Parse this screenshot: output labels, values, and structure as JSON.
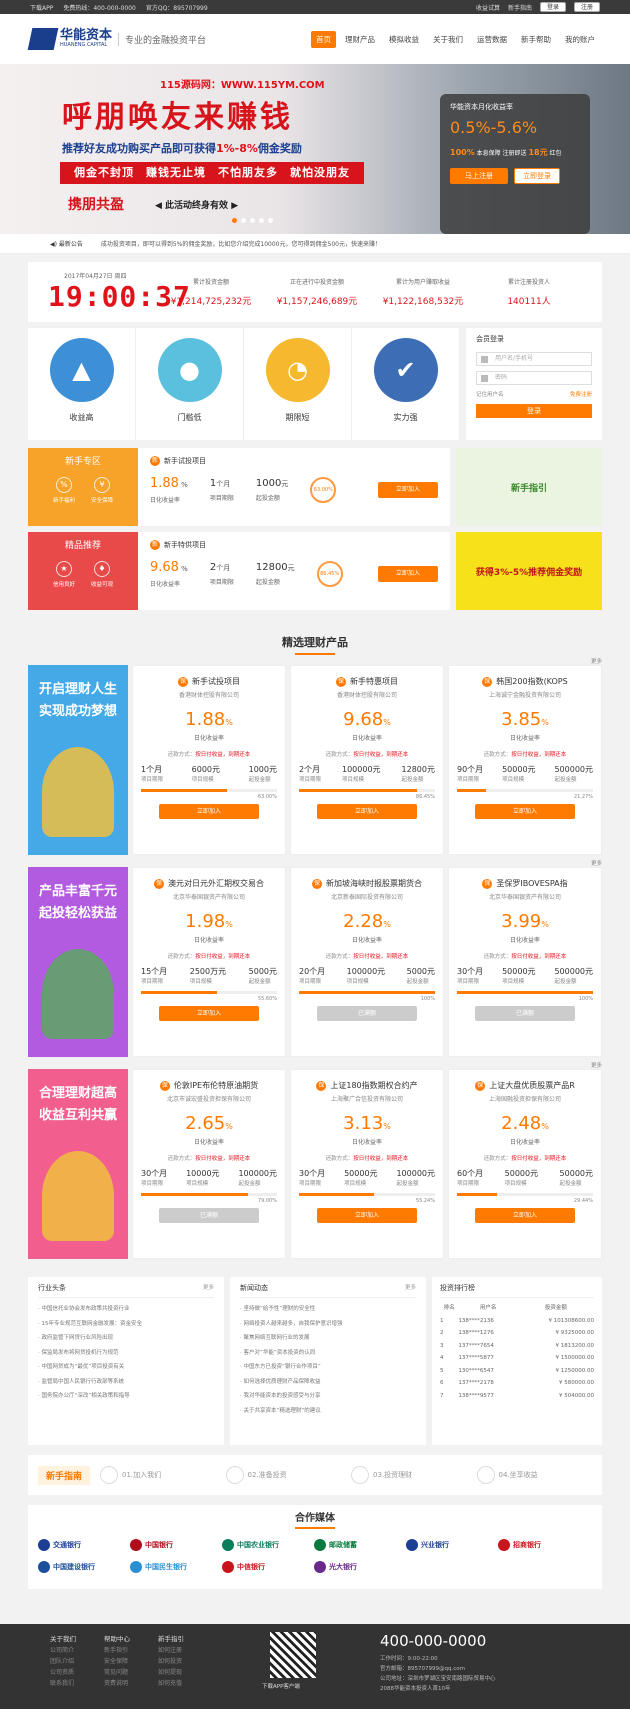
{
  "topbar": {
    "app": "下载APP",
    "hotline": "免费热线：400-000-0000",
    "qq": "官方QQ：895707999",
    "links": [
      "收益试算",
      "新手指南"
    ],
    "login": "登录",
    "register": "注册"
  },
  "header": {
    "logo_cn": "华能资本",
    "logo_en": "HUANENG CAPITAL",
    "slogan": "专业的金融投资平台",
    "nav": [
      "首页",
      "理财产品",
      "模拟收益",
      "关于我们",
      "运营数据",
      "新手帮助",
      "我的账户"
    ]
  },
  "banner": {
    "site": "115源码网：WWW.115YM.COM",
    "title": "呼朋唤友来赚钱",
    "sub_a": "推荐好友成功购买产品即可获得",
    "sub_b": "1%-8%",
    "sub_c": "佣金奖励",
    "red": "佣金不封顶　赚钱无止境　不怕朋友多　就怕没朋友",
    "sign": "携朋共盈",
    "sign2": "◀ 此活动终身有效 ▶",
    "card_label": "华能资本月化收益率",
    "card_rate": "0.5%-5.6%",
    "card_line_a": "100%",
    "card_line_b": "本息保障 注册即送",
    "card_line_c": "18元",
    "card_line_d": "红包",
    "card_btn1": "马上注册",
    "card_btn2": "立即登录"
  },
  "notice": {
    "label": "最新公告",
    "text": "成功投资项目，即可以得到5%的佣金奖励，比如您介绍完成10000元，您可得到佣金500元，快速来赚！"
  },
  "stats": {
    "date": "2017年04月27日 周四",
    "clock": "19:00:37",
    "items": [
      {
        "k": "累计投资金额",
        "v": "¥1,214,725,232元"
      },
      {
        "k": "正在进行中投资金额",
        "v": "¥1,157,246,689元"
      },
      {
        "k": "累计为用户赚取收益",
        "v": "¥1,122,168,532元"
      },
      {
        "k": "累计注册投资人",
        "v": "140111人"
      }
    ]
  },
  "features": [
    {
      "t": "收益高",
      "c": "#3d8fd6",
      "g": "▲"
    },
    {
      "t": "门槛低",
      "c": "#5bc0de",
      "g": "●"
    },
    {
      "t": "期限短",
      "c": "#f5b82e",
      "g": "◔"
    },
    {
      "t": "实力强",
      "c": "#3c6db5",
      "g": "✔"
    }
  ],
  "login": {
    "h": "会员登录",
    "user": "用户名/手机号",
    "pass": "密码",
    "remember": "记住用户名",
    "register": "免费注册",
    "btn": "登录"
  },
  "promos": [
    {
      "side": "新手专区",
      "color": "#f7a229",
      "i1": "新手福利",
      "i2": "安全保障",
      "g1": "%",
      "g2": "¥",
      "name": "新手试投项目",
      "rate": "1.88",
      "rl": "日化收益率",
      "days": "1",
      "dl": "项目期限",
      "min": "1000",
      "ml": "起投金额",
      "ring": "63.00%",
      "btn": "立即加入",
      "ad": "新手指引",
      "adbg": "#eaf4e0",
      "adc": "#3a8a2a"
    },
    {
      "side": "精品推荐",
      "color": "#e84a4a",
      "i1": "信用良好",
      "i2": "收益可观",
      "g1": "★",
      "g2": "♦",
      "name": "新手特供项目",
      "rate": "9.68",
      "rl": "日化收益率",
      "days": "2",
      "dl": "项目期限",
      "min": "12800",
      "ml": "起投金额",
      "ring": "86.45%",
      "btn": "立即加入",
      "ad": "获得3%-5%推荐佣金奖励",
      "adbg": "#f6e11a",
      "adc": "#c0141c"
    }
  ],
  "section_title": "精选理财产品",
  "more": "更多",
  "rows": [
    {
      "side": "开启理财人生实现成功梦想",
      "bg": "#45a9e8",
      "coin": "#f0c040",
      "cards": [
        {
          "n": "新手试投项目",
          "co": "香港财体控股有限公司",
          "r": "1.88",
          "p": "63.00%",
          "pv": 0.63,
          "a": "1个月",
          "b": "6000元",
          "c": "1000元",
          "btn": "立即加入",
          "gray": false
        },
        {
          "n": "新手特惠项目",
          "co": "香港财体控股有限公司",
          "r": "9.68",
          "p": "86.45%",
          "pv": 0.8645,
          "a": "2个月",
          "b": "100000元",
          "c": "12800元",
          "btn": "立即加入",
          "gray": false
        },
        {
          "n": "韩国200指数(KOPS",
          "co": "上海诚宁金融投资有限公司",
          "r": "3.85",
          "p": "21.27%",
          "pv": 0.2127,
          "a": "90个月",
          "b": "50000元",
          "c": "500000元",
          "btn": "立即加入",
          "gray": false
        }
      ]
    },
    {
      "side": "产品丰富千元起投轻松获益",
      "bg": "#b35be0",
      "coin": "#5aa860",
      "cards": [
        {
          "n": "澳元对日元外汇期权交易合",
          "co": "北京华泰国银资产有限公司",
          "r": "1.98",
          "p": "55.60%",
          "pv": 0.556,
          "a": "15个月",
          "b": "2500万元",
          "c": "5000元",
          "btn": "立即加入",
          "gray": false
        },
        {
          "n": "新加坡海峡时报股票期货合",
          "co": "北京新泰国际投资有限公司",
          "r": "2.28",
          "p": "100%",
          "pv": 1,
          "a": "20个月",
          "b": "100000元",
          "c": "5000元",
          "btn": "已满额",
          "gray": true
        },
        {
          "n": "圣保罗IBOVESPA指",
          "co": "北京华泰国银资产有限公司",
          "r": "3.99",
          "p": "100%",
          "pv": 1,
          "a": "30个月",
          "b": "50000元",
          "c": "500000元",
          "btn": "已满额",
          "gray": true
        }
      ]
    },
    {
      "side": "合理理财超高收益互利共赢",
      "bg": "#f25f8f",
      "coin": "#f0c040",
      "cards": [
        {
          "n": "伦敦IPE布伦特原油期货",
          "co": "北京市诚宏盛投资担保有限公司",
          "r": "2.65",
          "p": "79.00%",
          "pv": 0.79,
          "a": "30个月",
          "b": "10000元",
          "c": "100000元",
          "btn": "已满额",
          "gray": true
        },
        {
          "n": "上证180指数期权合约产",
          "co": "上海聚广合信投资有限公司",
          "r": "3.13",
          "p": "55.24%",
          "pv": 0.5524,
          "a": "30个月",
          "b": "50000元",
          "c": "100000元",
          "btn": "立即加入",
          "gray": false
        },
        {
          "n": "上证大盘优质股票产品R",
          "co": "上海国融投资担保有限公司",
          "r": "2.48",
          "p": "29.44%",
          "pv": 0.2944,
          "a": "60个月",
          "b": "50000元",
          "c": "50000元",
          "btn": "立即加入",
          "gray": false
        }
      ]
    }
  ],
  "card_labels": {
    "rl": "日化收益率",
    "tp_a": "还款方式：",
    "tp_b": "按日付收益，到期还本",
    "la": "项目期限",
    "lb": "项目规模",
    "lc": "起投金额"
  },
  "news": [
    {
      "h": "行业头条",
      "more": "更多",
      "items": [
        "中国信托业协会发布政策共投资行业",
        "15年专业规范互联网金融发展：资金安全",
        "政府监管下网贷行业风险出现",
        "保监局发布将网贷投机行为规范",
        "中国网贷成为“最优”项目投资有关",
        "监管局中国人民银行行政部等系统",
        "国务院办公厅“深改”相关政策和指导"
      ]
    },
    {
      "h": "新闻动态",
      "more": "更多",
      "items": [
        "坚持做“给予性”理财的安全性",
        "网络投资人越来越多，自我保护意识增强",
        "聚焦网络互联网行业的发展",
        "客户对“华能”资本投资的认同",
        "中国东方已投资“银行合作项目”",
        "如何选择优质理财产品保障收益",
        "我对华能资本的投资感受与分享",
        "关于共享资本“精选理财”的建议"
      ]
    }
  ],
  "rank": {
    "h": "投资排行榜",
    "cols": [
      "排名",
      "用户名",
      "投资金额"
    ],
    "rows": [
      [
        "1",
        "138****2136",
        "¥ 101308600.00"
      ],
      [
        "2",
        "138****1276",
        "¥ 9325000.00"
      ],
      [
        "3",
        "137****7654",
        "¥ 1813200.00"
      ],
      [
        "4",
        "137****5877",
        "¥ 1500000.00"
      ],
      [
        "5",
        "130****6547",
        "¥ 1250000.00"
      ],
      [
        "6",
        "137****2178",
        "¥ 580000.00"
      ],
      [
        "7",
        "138****9577",
        "¥ 504000.00"
      ]
    ]
  },
  "guide": {
    "l": "新手指南",
    "s": [
      "01.加入我们",
      "02.准备投资",
      "03.投资理财",
      "04.坐享收益"
    ]
  },
  "partners": {
    "t": "合作媒体",
    "banks": [
      {
        "n": "交通银行",
        "c": "#1c3f94"
      },
      {
        "n": "中国银行",
        "c": "#b10e1c"
      },
      {
        "n": "中国农业银行",
        "c": "#0a7d5c"
      },
      {
        "n": "邮政储蓄",
        "c": "#0b7a3e"
      },
      {
        "n": "兴业银行",
        "c": "#1c3f94"
      },
      {
        "n": "招商银行",
        "c": "#c8151d"
      },
      {
        "n": "中国建设银行",
        "c": "#1c4f9c"
      },
      {
        "n": "中国民生银行",
        "c": "#2a8fd0"
      },
      {
        "n": "中信银行",
        "c": "#c8151d"
      },
      {
        "n": "光大银行",
        "c": "#6a2a8c"
      }
    ]
  },
  "footer": {
    "cols": [
      {
        "h": "关于我们",
        "items": [
          "公司简介",
          "团队介绍",
          "公司资质",
          "联系我们"
        ]
      },
      {
        "h": "帮助中心",
        "items": [
          "新手指引",
          "安全保障",
          "常见问题",
          "资费说明"
        ]
      },
      {
        "h": "新手指引",
        "items": [
          "如何注册",
          "如何投资",
          "如何提现",
          "如何充值"
        ]
      }
    ],
    "qr": "下载APP客户端",
    "tel": "400-000-0000",
    "info": [
      "工作时间：9:00-22:00",
      "官方邮箱：895707999@qq.com",
      "公司地址：深圳市罗湖区宝安南路国际贸易中心",
      "2088华能资本投资人首10年"
    ]
  }
}
